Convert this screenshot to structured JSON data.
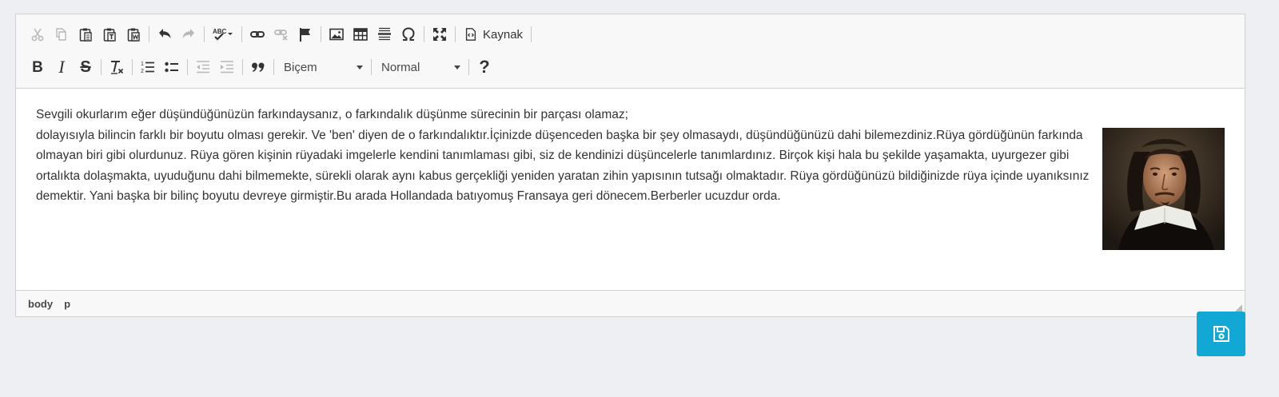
{
  "toolbar": {
    "row1": [
      {
        "name": "cut-button",
        "icon": "scissors-icon",
        "disabled": true
      },
      {
        "name": "copy-button",
        "icon": "copy-icon",
        "disabled": true
      },
      {
        "name": "paste-button",
        "icon": "clipboard-icon"
      },
      {
        "name": "paste-text-button",
        "icon": "clipboard-text-icon"
      },
      {
        "name": "paste-word-button",
        "icon": "clipboard-word-icon"
      },
      {
        "name": "undo-button",
        "icon": "undo-icon"
      },
      {
        "name": "redo-button",
        "icon": "redo-icon",
        "disabled": true
      },
      {
        "name": "spellcheck-button",
        "icon": "spellcheck-icon"
      },
      {
        "name": "link-button",
        "icon": "link-icon"
      },
      {
        "name": "unlink-button",
        "icon": "unlink-icon",
        "disabled": true
      },
      {
        "name": "anchor-button",
        "icon": "flag-icon"
      },
      {
        "name": "image-button",
        "icon": "image-icon"
      },
      {
        "name": "table-button",
        "icon": "table-icon"
      },
      {
        "name": "horizontal-rule-button",
        "icon": "horizontal-rule-icon"
      },
      {
        "name": "special-char-button",
        "icon": "omega-icon"
      },
      {
        "name": "maximize-button",
        "icon": "maximize-icon"
      }
    ],
    "source_label": "Kaynak",
    "style_combo": "Biçem",
    "format_combo": "Normal",
    "help_glyph": "?",
    "bold_glyph": "B",
    "italic_glyph": "I",
    "strike_glyph": "S",
    "quote_glyph": "❞"
  },
  "content": {
    "line1": "Sevgili okurlarım eğer düşündüğünüzün farkındaysanız, o farkındalık düşünme sürecinin bir parçası olamaz;",
    "paragraph": "dolayısıyla bilincin farklı bir boyutu olması gerekir. Ve 'ben' diyen de o farkındalıktır.İçinizde düşenceden başka bir şey olmasaydı, düşündüğünüzü dahi bilemezdiniz.Rüya gördüğünün farkında olmayan biri gibi olurdunuz. Rüya gören kişinin rüyadaki imgelerle kendini tanımlaması gibi, siz de kendinizi düşüncelerle tanımlardınız. Birçok kişi hala bu şekilde yaşamakta, uyurgezer gibi ortalıkta dolaşmakta, uyuduğunu dahi bilmemekte, sürekli olarak aynı kabus gerçekliği yeniden yaratan zihin yapısının tutsağı olmaktadır. Rüya gördüğünüzü bildiğinizde rüya içinde uyanıksınız demektir. Yani başka bir bilinç boyutu devreye girmiştir.Bu arada Hollandada batıyomuş Fransaya geri dönecem.Berberler ucuzdur orda."
  },
  "statusbar": {
    "crumbs": [
      "body",
      "p"
    ]
  },
  "colors": {
    "accent": "#12a8d6",
    "toolbar_bg": "#f8f8f8",
    "page_bg": "#edeff3"
  }
}
